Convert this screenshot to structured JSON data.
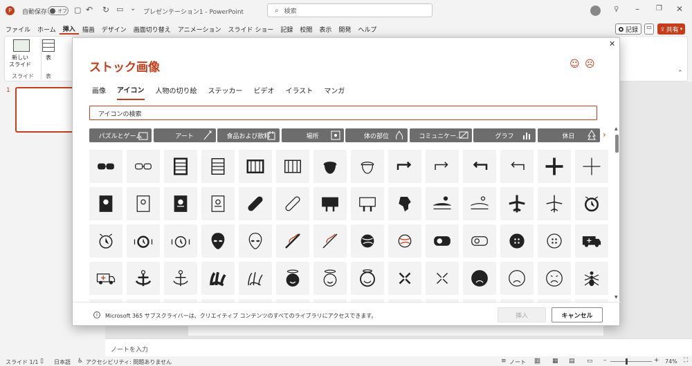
{
  "titlebar": {
    "autosave_label": "自動保存",
    "autosave_state": "オフ",
    "doc_title": "プレゼンテーション1 - PowerPoint",
    "search_placeholder": "検索"
  },
  "ribbon_tabs": [
    "ファイル",
    "ホーム",
    "挿入",
    "描画",
    "デザイン",
    "画面切り替え",
    "アニメーション",
    "スライド ショー",
    "記録",
    "校閲",
    "表示",
    "開発",
    "ヘルプ"
  ],
  "ribbon_right": {
    "record": "記録",
    "share": "共有"
  },
  "ribbon": {
    "new_slide": "新しい",
    "new_slide2": "スライド",
    "slide_group": "スライド",
    "table": "表",
    "table_group": "表"
  },
  "thumb": {
    "num": "1"
  },
  "notes": "ノートを入力",
  "status": {
    "slide": "スライド 1/1",
    "lang": "日本語",
    "access": "アクセシビリティ: 問題ありません",
    "notes": "ノート",
    "zoom": "74%"
  },
  "dialog": {
    "title": "ストック画像",
    "tabs": [
      "画像",
      "アイコン",
      "人物の切り絵",
      "ステッカー",
      "ビデオ",
      "イラスト",
      "マンガ"
    ],
    "active_tab": 1,
    "search_value": "アイコンの検索",
    "chips": [
      "パズルとゲーム",
      "アート",
      "食品および飲料",
      "場所",
      "体の部位",
      "コミュニケー...",
      "グラフ",
      "休日"
    ],
    "footer_text": "Microsoft 365 サブスクライバーは、クリエイティブ コンテンツのすべてのライブラリにアクセスできます。",
    "insert": "挿入",
    "cancel": "キャンセル"
  },
  "icons": [
    [
      "3d-glasses-icon",
      "3d-glasses-outline-icon",
      "abacus-icon",
      "abacus-outline-icon",
      "abacus-wide-icon",
      "abacus-wide-outline-icon",
      "acorn-icon",
      "acorn-outline-icon",
      "arrow-curve-right-icon",
      "arrow-curve-right-outline-icon",
      "arrow-curve-left-icon",
      "arrow-curve-left-outline-icon",
      "plus-icon",
      "plus-outline-icon"
    ],
    [
      "address-book-icon",
      "address-book-outline-icon",
      "address-book-alt-icon",
      "address-book-alt-outline-icon",
      "bandage-icon",
      "bandage-outline-icon",
      "billboard-icon",
      "billboard-outline-icon",
      "africa-icon",
      "agriculture-icon",
      "agriculture-outline-icon",
      "airplane-icon",
      "airplane-outline-icon",
      "alarm-clock-icon"
    ],
    [
      "alarm-clock-outline-icon",
      "alarm-ringing-icon",
      "alarm-ringing-outline-icon",
      "alien-icon",
      "alien-outline-icon",
      "needle-icon",
      "needle-outline-icon",
      "yarn-icon",
      "yarn-outline-icon",
      "measuring-tape-icon",
      "measuring-tape-outline-icon",
      "button-icon",
      "button-outline-icon",
      "ambulance-icon"
    ],
    [
      "ambulance-outline-icon",
      "anchor-icon",
      "anchor-outline-icon",
      "coral-icon",
      "coral-outline-icon",
      "angel-face-icon",
      "angel-face-outline-icon",
      "angel-smile-icon",
      "angry-face-icon",
      "angry-face-outline-icon",
      "frowning-face-icon",
      "frowning-face-outline-icon",
      "sad-face-outline-icon",
      "ant-icon"
    ]
  ]
}
